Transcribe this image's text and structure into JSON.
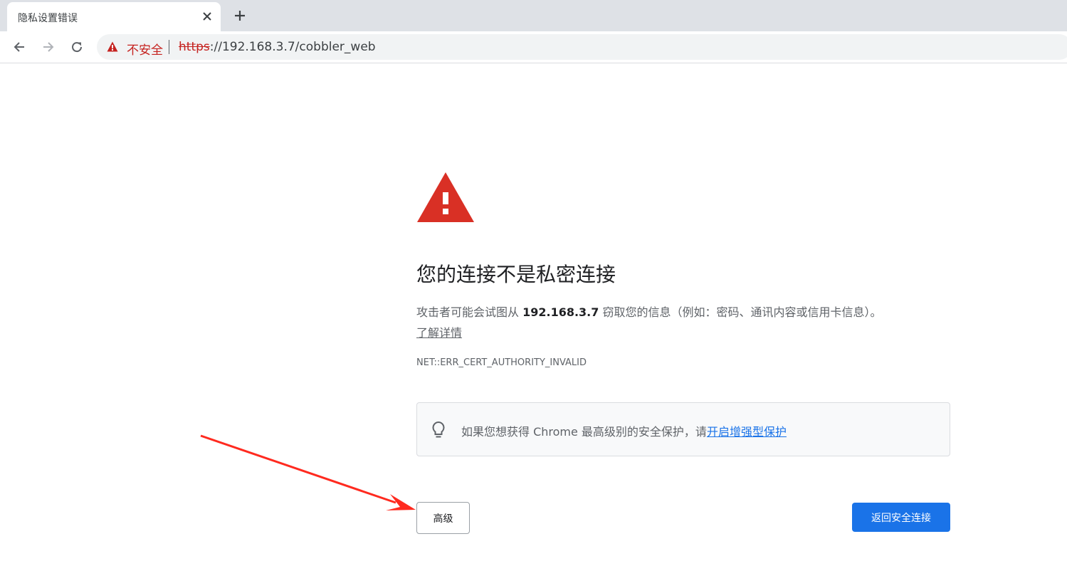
{
  "browser": {
    "tab": {
      "title": "隐私设置错误",
      "close_icon": "close-icon"
    },
    "new_tab_icon": "plus-icon",
    "nav": {
      "back_icon": "arrow-left-icon",
      "forward_icon": "arrow-right-icon",
      "reload_icon": "reload-icon"
    },
    "omnibox": {
      "security_label": "不安全",
      "url_scheme": "https",
      "url_rest": "://192.168.3.7/cobbler_web"
    }
  },
  "page": {
    "warning_icon": "warning-triangle-icon",
    "title": "您的连接不是私密连接",
    "description_prefix": "攻击者可能会试图从 ",
    "host": "192.168.3.7",
    "description_suffix": " 窃取您的信息（例如：密码、通讯内容或信用卡信息）。",
    "learn_more": "了解详情",
    "error_code": "NET::ERR_CERT_AUTHORITY_INVALID",
    "enhanced": {
      "icon": "lightbulb-icon",
      "text": "如果您想获得 Chrome 最高级别的安全保护，请",
      "link": "开启增强型保护"
    },
    "advanced_label": "高级",
    "back_label": "返回安全连接"
  },
  "colors": {
    "danger": "#c5221f",
    "warning_triangle": "#d93025",
    "primary": "#1a73e8",
    "annotation_arrow": "#ff2a1f"
  }
}
